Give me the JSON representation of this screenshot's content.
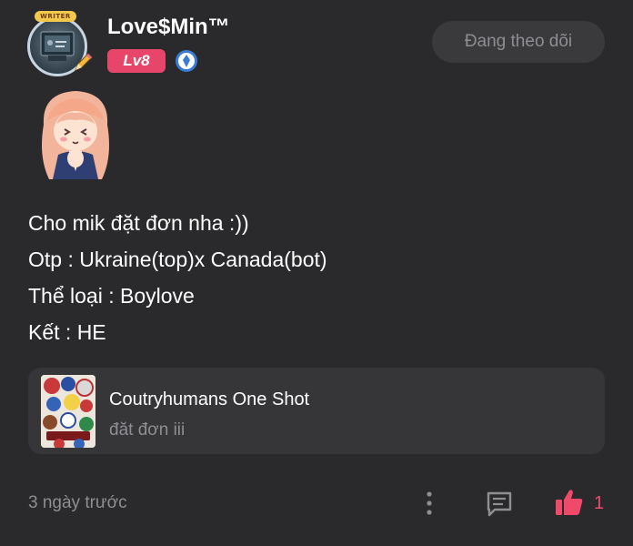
{
  "header": {
    "username": "Love$Min™",
    "avatar_frame_label": "WRITER",
    "level": "Lv8",
    "verified_icon": "diamond-badge-icon",
    "follow_button": "Đang theo dõi"
  },
  "post": {
    "lines": [
      "Cho mik đặt đơn nha :))",
      "Otp : Ukraine(top)x Canada(bot)",
      "Thể loại : Boylove",
      "Kết : HE"
    ]
  },
  "link_card": {
    "title": "Coutryhumans One Shot",
    "subtitle": "đăt đơn iii"
  },
  "footer": {
    "timestamp": "3 ngày trước",
    "like_count": "1"
  },
  "colors": {
    "background": "#2a2a2c",
    "level_badge": "#e8456a",
    "like_accent": "#f04a6a",
    "muted_text": "#8f8f93"
  }
}
